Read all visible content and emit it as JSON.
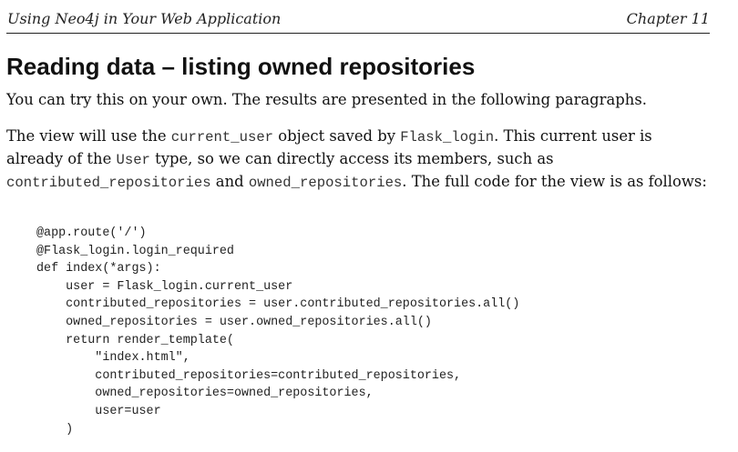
{
  "header": {
    "book_title": "Using Neo4j in Your Web Application",
    "chapter": "Chapter 11"
  },
  "section": {
    "title": "Reading data – listing owned repositories"
  },
  "paragraph1": "You can try this on your own. The results are presented in the following paragraphs.",
  "paragraph2": {
    "t1": "The view will use the ",
    "c1": "current_user",
    "t2": " object saved by ",
    "c2": "Flask_login",
    "t3": ". This current user is already of the ",
    "c3": "User",
    "t4": " type, so we can directly access its members, such as ",
    "c4": "contributed_repositories",
    "t5": " and ",
    "c5": "owned_repositories",
    "t6": ". The full code for the view is as follows:"
  },
  "code_lines": [
    "@app.route('/')",
    "@Flask_login.login_required",
    "def index(*args):",
    "    user = Flask_login.current_user",
    "    contributed_repositories = user.contributed_repositories.all()",
    "    owned_repositories = user.owned_repositories.all()",
    "    return render_template(",
    "        \"index.html\",",
    "        contributed_repositories=contributed_repositories,",
    "        owned_repositories=owned_repositories,",
    "        user=user",
    "    )"
  ]
}
